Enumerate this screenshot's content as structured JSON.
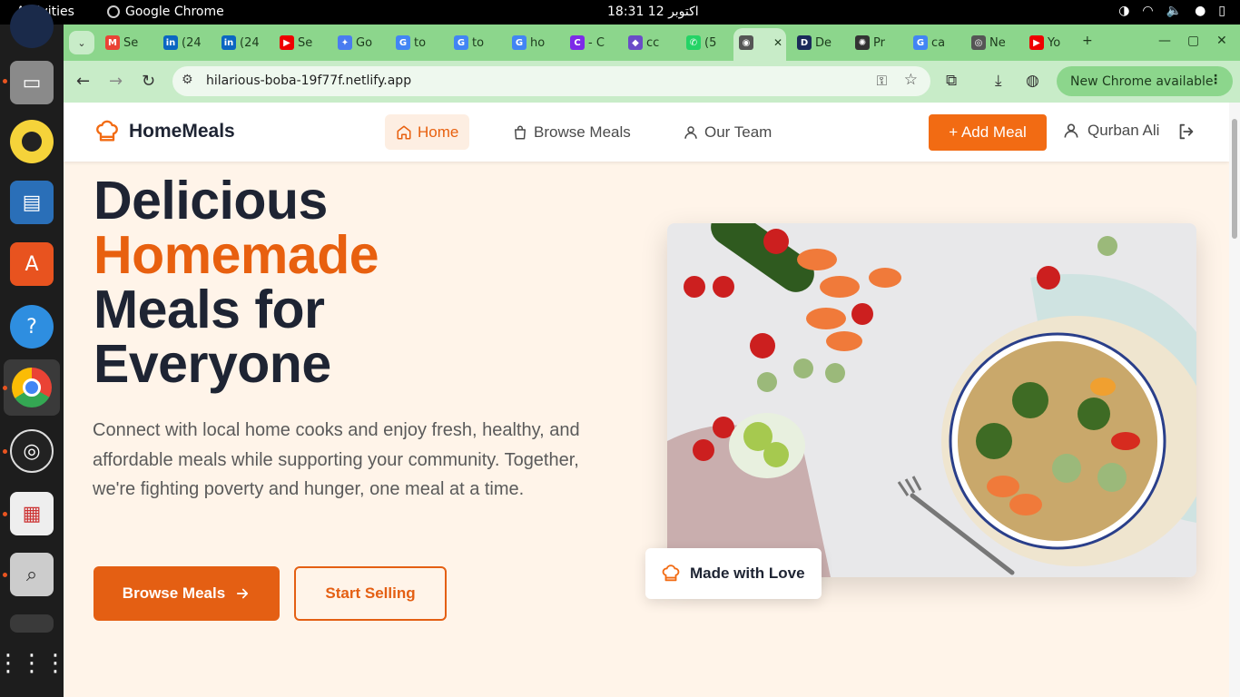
{
  "system": {
    "activities": "Activities",
    "app_name": "Google Chrome",
    "clock": "18:31  12 اکتوبر"
  },
  "browser": {
    "tabs": [
      {
        "label": "Se",
        "icon": "gmail-icon"
      },
      {
        "label": "(24",
        "icon": "linkedin-icon"
      },
      {
        "label": "(24",
        "icon": "linkedin-icon"
      },
      {
        "label": "Se",
        "icon": "youtube-icon"
      },
      {
        "label": "Go",
        "icon": "gemini-icon"
      },
      {
        "label": "to",
        "icon": "google-icon"
      },
      {
        "label": "to",
        "icon": "google-icon"
      },
      {
        "label": "ho",
        "icon": "google-icon"
      },
      {
        "label": "- C",
        "icon": "canva-icon"
      },
      {
        "label": "cc",
        "icon": "app-icon"
      },
      {
        "label": "(5",
        "icon": "whatsapp-icon"
      },
      {
        "label": "",
        "icon": "globe-icon"
      },
      {
        "label": "De",
        "icon": "d-icon"
      },
      {
        "label": "Pr",
        "icon": "openai-icon"
      },
      {
        "label": "ca",
        "icon": "google-icon"
      },
      {
        "label": "Ne",
        "icon": "chrome-icon"
      },
      {
        "label": "Yo",
        "icon": "youtube-icon"
      }
    ],
    "url": "hilarious-boba-19f77f.netlify.app",
    "update_button": "New Chrome available"
  },
  "site": {
    "brand": "HomeMeals",
    "nav": {
      "home": "Home",
      "browse": "Browse Meals",
      "team": "Our Team"
    },
    "add_meal": "+ Add Meal",
    "user_name": "Qurban Ali",
    "hero": {
      "title_line1": "Delicious",
      "title_line2": "Homemade",
      "title_line3": "Meals for",
      "title_line4": "Everyone",
      "description": "Connect with local home cooks and enjoy fresh, healthy, and affordable meals while supporting your community. Together, we're fighting poverty and hunger, one meal at a time.",
      "browse_button": "Browse Meals",
      "sell_button": "Start Selling",
      "badge": "Made with Love"
    },
    "colors": {
      "accent": "#e8600f",
      "heading": "#1e2433",
      "background": "#fff4e9"
    }
  }
}
